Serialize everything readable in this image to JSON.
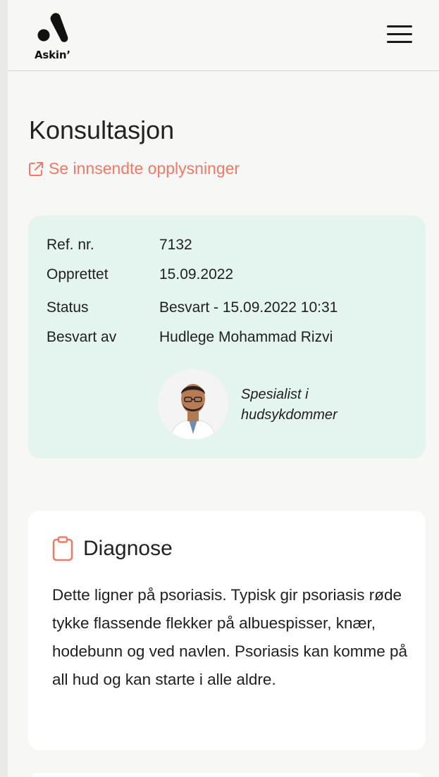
{
  "header": {
    "logo_text": "Askin’",
    "menu_icon": "hamburger-menu-icon"
  },
  "page": {
    "title": "Konsultasjon",
    "submitted_link": "Se innsendte opplysninger",
    "link_icon": "external-link-icon",
    "accent_color": "#ef7a67"
  },
  "consultation": {
    "ref_label": "Ref. nr.",
    "ref_value": "7132",
    "created_label": "Opprettet",
    "created_value": "15.09.2022",
    "status_label": "Status",
    "status_value": "Besvart - 15.09.2022 10:31",
    "answered_by_label": "Besvart av",
    "answered_by_value": "Hudlege Mohammad Rizvi",
    "role_line1": "Spesialist i",
    "role_line2": "hudsykdommer",
    "card_color": "#e4f4ee"
  },
  "diagnosis": {
    "icon": "clipboard-icon",
    "title": "Diagnose",
    "text": "Dette ligner på psoriasis. Typisk gir psoriasis røde tykke flassende flekker på albuespisser, knær, hodebunn og ved navlen. Psoriasis kan komme på all hud og kan starte i alle aldre."
  }
}
